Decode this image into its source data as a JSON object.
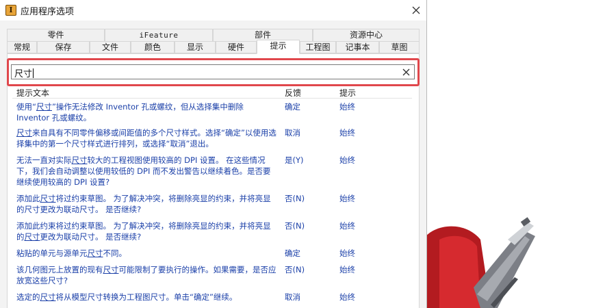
{
  "window": {
    "title": "应用程序选项",
    "icon_letter": "I"
  },
  "tabs_top": [
    "零件",
    "iFeature",
    "部件",
    "资源中心"
  ],
  "tabs_bottom": [
    "常规",
    "保存",
    "文件",
    "颜色",
    "显示",
    "硬件",
    "提示",
    "工程图",
    "记事本",
    "草图"
  ],
  "active_tab": "提示",
  "search": {
    "value": "尺寸"
  },
  "columns": {
    "text": "提示文本",
    "feedback": "反馈",
    "prompt": "提示"
  },
  "rows": [
    {
      "pre": "使用“",
      "kw": "尺寸",
      "post": "”操作无法修改 Inventor 孔或螺纹，但从选择集中删除 Inventor 孔或螺纹。",
      "feedback": "确定",
      "prompt": "始终"
    },
    {
      "pre": "",
      "kw": "尺寸",
      "post": "来自具有不同零件偏移或间距值的多个尺寸样式。选择“确定”以使用选择集中的第一个尺寸样式进行排列，或选择“取消”退出。",
      "feedback": "取消",
      "prompt": "始终"
    },
    {
      "pre": "无法一直对实际",
      "kw": "尺寸",
      "post": "较大的工程视图使用较高的 DPI 设置。 在这些情况下，我们会自动调整以使用较低的 DPI 而不发出警告以继续着色。是否要继续使用较高的 DPI 设置?",
      "feedback": "是(Y)",
      "prompt": "始终"
    },
    {
      "pre": "添加此",
      "kw": "尺寸",
      "post": "将过约束草图。 为了解决冲突，将删除亮显的约束，并将亮显的尺寸更改为联动尺寸。 是否继续?",
      "feedback": "否(N)",
      "prompt": "始终"
    },
    {
      "pre": "添加此约束将过约束草图。 为了解决冲突，将删除亮显的约束，并将亮显的",
      "kw": "尺寸",
      "post": "更改为联动尺寸。 是否继续?",
      "feedback": "否(N)",
      "prompt": "始终"
    },
    {
      "pre": "粘贴的单元与源单元",
      "kw": "尺寸",
      "post": "不同。",
      "feedback": "确定",
      "prompt": "始终"
    },
    {
      "pre": "该几何图元上放置的现有",
      "kw": "尺寸",
      "post": "可能限制了要执行的操作。如果需要，是否应放宽这些尺寸?",
      "feedback": "否(N)",
      "prompt": "始终"
    },
    {
      "pre": "选定的",
      "kw": "尺寸",
      "post": "将从模型尺寸转换为工程图尺寸。单击“确定”继续。",
      "feedback": "取消",
      "prompt": "始终"
    }
  ],
  "colors": {
    "accent_link": "#1a3fa8",
    "highlight": "#e0474c"
  },
  "icons": {
    "close": "close-icon",
    "clear": "clear-icon",
    "app": "inventor-app-icon"
  }
}
